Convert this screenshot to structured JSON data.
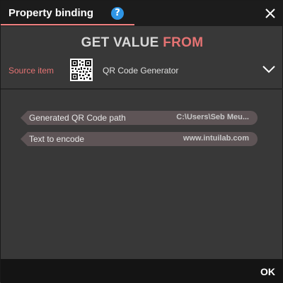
{
  "header": {
    "title": "Property binding",
    "help_symbol": "?"
  },
  "heading": {
    "main": "GET VALUE ",
    "accent": "FROM"
  },
  "source": {
    "label": "Source item",
    "value": "QR Code Generator",
    "icon": "qr-code-icon"
  },
  "properties": [
    {
      "label": "Generated QR Code path",
      "value": "C:\\Users\\Seb Meu..."
    },
    {
      "label": "Text to encode",
      "value": "www.intuilab.com"
    }
  ],
  "footer": {
    "ok_label": "OK"
  },
  "colors": {
    "accent": "#e57373",
    "help": "#2e95e6",
    "pill": "#5e5456",
    "header_bg": "#1c1c1c",
    "body_bg": "#383838"
  }
}
